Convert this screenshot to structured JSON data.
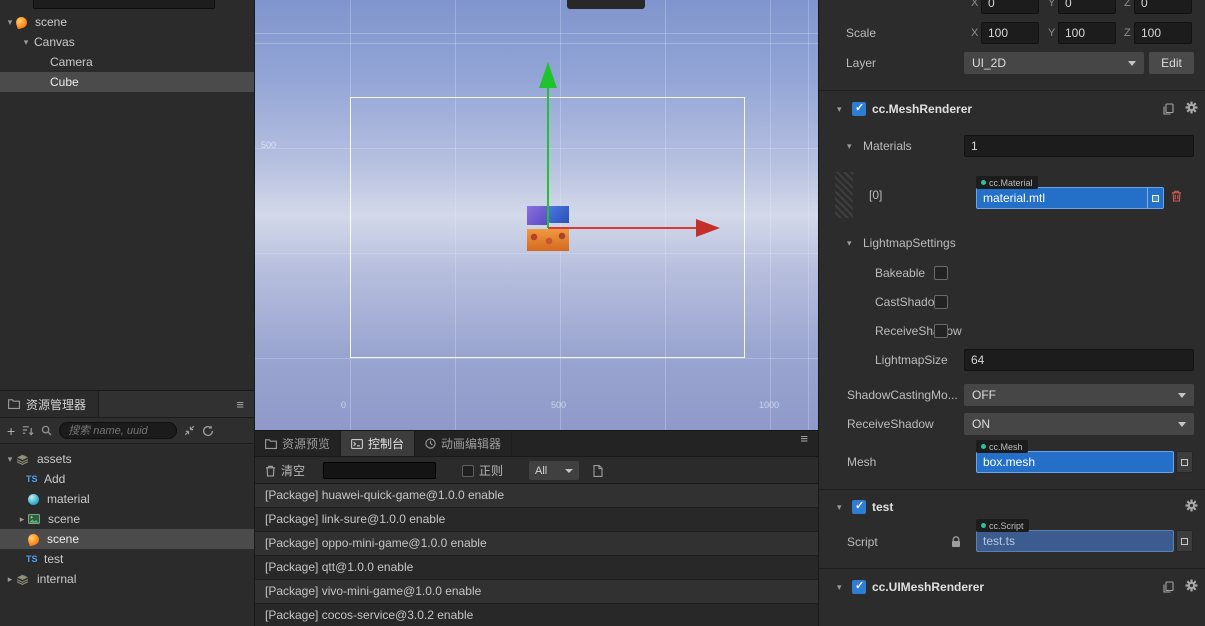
{
  "hierarchy": {
    "items": [
      {
        "label": "scene"
      },
      {
        "label": "Canvas"
      },
      {
        "label": "Camera"
      },
      {
        "label": "Cube"
      }
    ]
  },
  "assets": {
    "title": "资源管理器",
    "search_placeholder": "搜索 name, uuid",
    "items": [
      {
        "label": "assets"
      },
      {
        "label": "Add"
      },
      {
        "label": "material"
      },
      {
        "label": "scene"
      },
      {
        "label": "scene"
      },
      {
        "label": "test"
      },
      {
        "label": "internal"
      }
    ]
  },
  "viewport": {
    "ruler_left": "500",
    "ruler_bottom": [
      "0",
      "500",
      "1000"
    ]
  },
  "console": {
    "tabs": [
      "资源预览",
      "控制台",
      "动画编辑器"
    ],
    "clear_label": "清空",
    "regex_label": "正则",
    "filter_value": "All",
    "logs": [
      "[Package] huawei-quick-game@1.0.0 enable",
      "[Package] link-sure@1.0.0 enable",
      "[Package] oppo-mini-game@1.0.0 enable",
      "[Package] qtt@1.0.0 enable",
      "[Package] vivo-mini-game@1.0.0 enable",
      "[Package] cocos-service@3.0.2 enable"
    ]
  },
  "inspector": {
    "rotation": {
      "x_label": "X",
      "x": "0",
      "y_label": "Y",
      "y": "0",
      "z_label": "Z",
      "z": "0"
    },
    "scale": {
      "label": "Scale",
      "x_label": "X",
      "x": "100",
      "y_label": "Y",
      "y": "100",
      "z_label": "Z",
      "z": "100"
    },
    "layer": {
      "label": "Layer",
      "value": "UI_2D",
      "edit_label": "Edit"
    },
    "mesh_renderer": {
      "title": "cc.MeshRenderer",
      "materials_label": "Materials",
      "materials_count": "1",
      "slot_index": "[0]",
      "slot_type": "cc.Material",
      "slot_value": "material.mtl",
      "lightmap_label": "LightmapSettings",
      "bakeable_label": "Bakeable",
      "cast_shadow_label": "CastShadow",
      "receive_shadow_label": "ReceiveShadow",
      "lightmap_size_label": "LightmapSize",
      "lightmap_size": "64",
      "shadow_casting_label": "ShadowCastingMo...",
      "shadow_casting_value": "OFF",
      "receive_shadow2_label": "ReceiveShadow",
      "receive_shadow2_value": "ON",
      "mesh_label": "Mesh",
      "mesh_type": "cc.Mesh",
      "mesh_value": "box.mesh"
    },
    "test_component": {
      "title": "test",
      "script_label": "Script",
      "script_type": "cc.Script",
      "script_value": "test.ts"
    },
    "ui_mesh_renderer": {
      "title": "cc.UIMeshRenderer"
    }
  }
}
